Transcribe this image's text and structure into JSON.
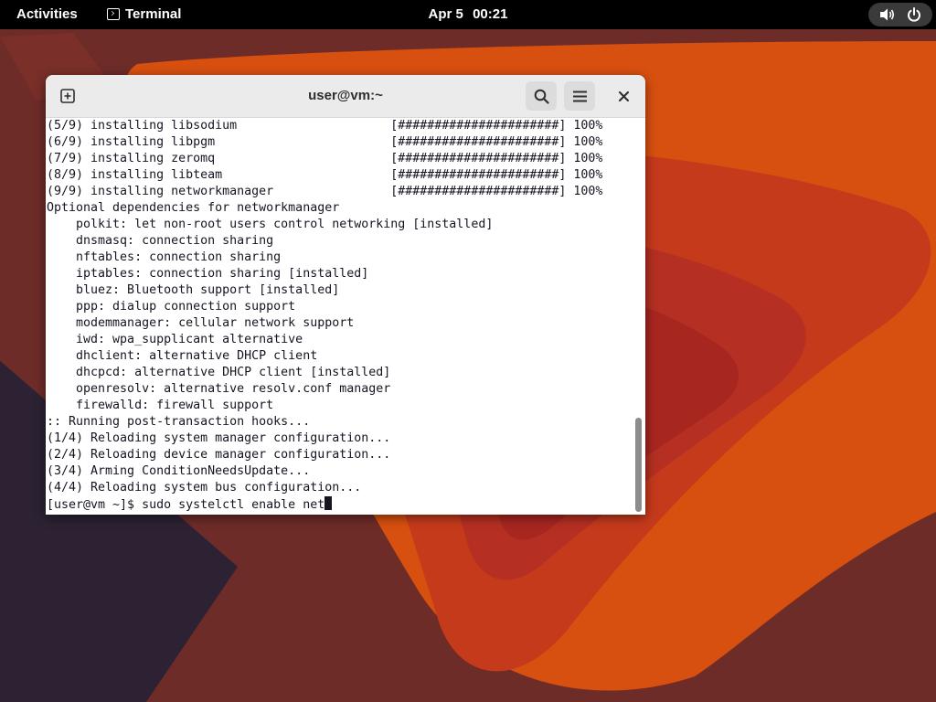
{
  "topbar": {
    "activities_label": "Activities",
    "app_name": "Terminal",
    "clock_date": "Apr 5",
    "clock_time": "00:21"
  },
  "window": {
    "title": "user@vm:~"
  },
  "icons": {
    "new_tab": "new-tab-icon",
    "search": "search-icon",
    "menu": "hamburger-menu-icon",
    "close": "close-icon",
    "volume": "volume-icon",
    "power": "power-icon",
    "terminal": "terminal-icon"
  },
  "terminal": {
    "lines": [
      "(5/9) installing libsodium                     [######################] 100%",
      "(6/9) installing libpgm                        [######################] 100%",
      "(7/9) installing zeromq                        [######################] 100%",
      "(8/9) installing libteam                       [######################] 100%",
      "(9/9) installing networkmanager                [######################] 100%",
      "Optional dependencies for networkmanager",
      "    polkit: let non-root users control networking [installed]",
      "    dnsmasq: connection sharing",
      "    nftables: connection sharing",
      "    iptables: connection sharing [installed]",
      "    bluez: Bluetooth support [installed]",
      "    ppp: dialup connection support",
      "    modemmanager: cellular network support",
      "    iwd: wpa_supplicant alternative",
      "    dhclient: alternative DHCP client",
      "    dhcpcd: alternative DHCP client [installed]",
      "    openresolv: alternative resolv.conf manager",
      "    firewalld: firewall support",
      ":: Running post-transaction hooks...",
      "(1/4) Reloading system manager configuration...",
      "(2/4) Reloading device manager configuration...",
      "(3/4) Arming ConditionNeedsUpdate...",
      "(4/4) Reloading system bus configuration..."
    ],
    "prompt": "[user@vm ~]$ ",
    "command_input": "sudo systelctl enable net"
  },
  "colors": {
    "topbar_bg": "#000000",
    "headerbar_bg": "#ebebeb",
    "terminal_bg": "#ffffff",
    "terminal_fg": "#171421",
    "wallpaper_base": "#6b2a25",
    "wallpaper_orange": "#d9480f",
    "wallpaper_red": "#b02a26"
  }
}
